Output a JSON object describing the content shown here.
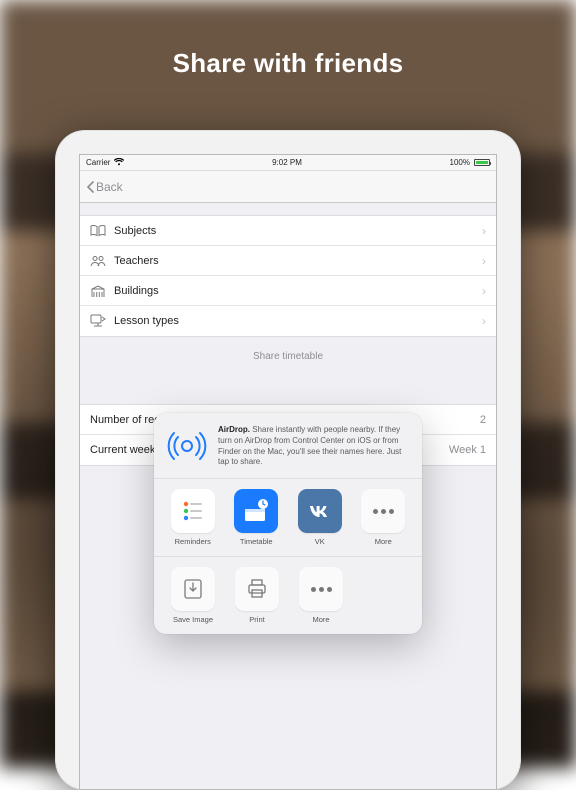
{
  "hero": "Share with friends",
  "statusbar": {
    "carrier": "Carrier",
    "time": "9:02 PM",
    "battery": "100%"
  },
  "navbar": {
    "back": "Back"
  },
  "menu": {
    "items": [
      {
        "label": "Subjects"
      },
      {
        "label": "Teachers"
      },
      {
        "label": "Buildings"
      },
      {
        "label": "Lesson types"
      }
    ]
  },
  "share_header": "Share timetable",
  "settings": {
    "recurring_label": "Number of recurring w",
    "recurring_value": "2",
    "current_week_label": "Current week",
    "current_week_value": "Week 1"
  },
  "sharesheet": {
    "airdrop_bold": "AirDrop.",
    "airdrop_text": " Share instantly with people nearby. If they turn on AirDrop from Control Center on iOS or from Finder on the Mac, you'll see their names here. Just tap to share.",
    "apps": [
      {
        "label": "Reminders"
      },
      {
        "label": "Timetable"
      },
      {
        "label": "VK"
      },
      {
        "label": "More"
      }
    ],
    "actions": [
      {
        "label": "Save Image"
      },
      {
        "label": "Print"
      },
      {
        "label": "More"
      }
    ]
  }
}
